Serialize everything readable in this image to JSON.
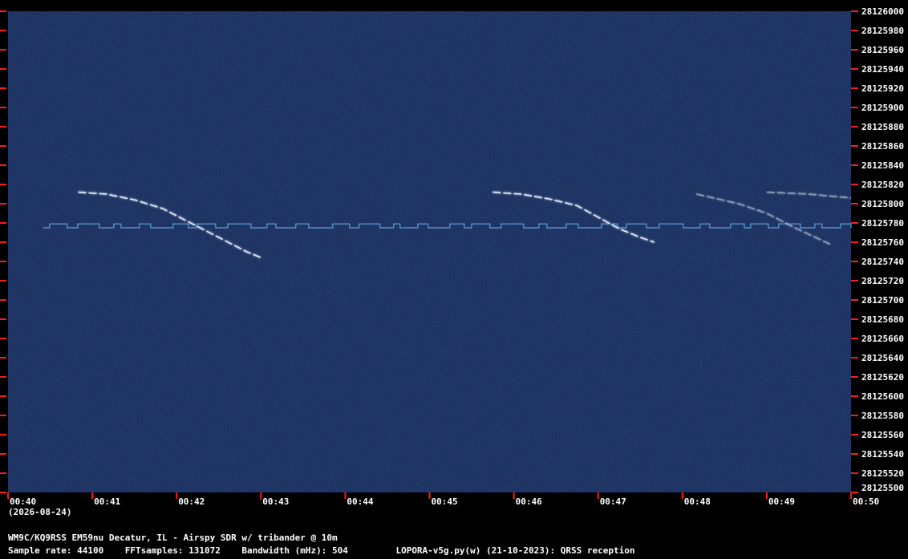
{
  "chart_data": {
    "type": "heatmap",
    "title": "",
    "xlabel": "",
    "ylabel": "",
    "x_ticks": [
      "00:40",
      "00:41",
      "00:42",
      "00:43",
      "00:44",
      "00:45",
      "00:46",
      "00:47",
      "00:48",
      "00:49",
      "00:50"
    ],
    "xlim": [
      "00:40",
      "00:50"
    ],
    "date_label": "(2026-08-24)",
    "y_ticks": [
      28126000,
      28125980,
      28125960,
      28125940,
      28125920,
      28125900,
      28125880,
      28125860,
      28125840,
      28125820,
      28125800,
      28125780,
      28125760,
      28125740,
      28125720,
      28125700,
      28125680,
      28125660,
      28125640,
      28125620,
      28125600,
      28125580,
      28125560,
      28125540,
      28125520,
      28125500
    ],
    "ylim": [
      28125500,
      28126000
    ],
    "grid": false,
    "colors": {
      "background": "#0d1f4a",
      "signal": "#e8f2ff",
      "tick_marks": "#ff1a1a",
      "carrier": "#5b9bd6"
    },
    "carrier": {
      "freq": 28125775,
      "alt_freq": 28125779,
      "t_start": "00:40:25",
      "t_end": "00:50:00"
    },
    "traces": [
      {
        "points": [
          [
            "00:40:50",
            28125812
          ],
          [
            "00:41:10",
            28125810
          ],
          [
            "00:41:30",
            28125804
          ],
          [
            "00:41:50",
            28125795
          ],
          [
            "00:42:10",
            28125780
          ],
          [
            "00:42:30",
            28125765
          ],
          [
            "00:42:50",
            28125750
          ],
          [
            "00:43:00",
            28125744
          ]
        ]
      },
      {
        "points": [
          [
            "00:45:45",
            28125812
          ],
          [
            "00:46:05",
            28125810
          ],
          [
            "00:46:25",
            28125805
          ],
          [
            "00:46:45",
            28125798
          ],
          [
            "00:47:00",
            28125786
          ],
          [
            "00:47:15",
            28125774
          ],
          [
            "00:47:30",
            28125765
          ],
          [
            "00:47:40",
            28125760
          ]
        ]
      },
      {
        "points": [
          [
            "00:48:10",
            28125810
          ],
          [
            "00:48:40",
            28125800
          ],
          [
            "00:49:00",
            28125790
          ],
          [
            "00:49:20",
            28125775
          ],
          [
            "00:49:45",
            28125758
          ]
        ]
      },
      {
        "points": [
          [
            "00:49:00",
            28125812
          ],
          [
            "00:49:30",
            28125810
          ],
          [
            "00:50:00",
            28125806
          ]
        ]
      }
    ]
  },
  "footer": {
    "line1": "WM9C/KQ9RSS EM59nu Decatur, IL - Airspy SDR w/ tribander @ 10m",
    "line2": "Sample rate: 44100    FFTsamples: 131072    Bandwidth (mHz): 504         LOPORA-v5g.py(w) (21-10-2023): QRSS reception"
  }
}
